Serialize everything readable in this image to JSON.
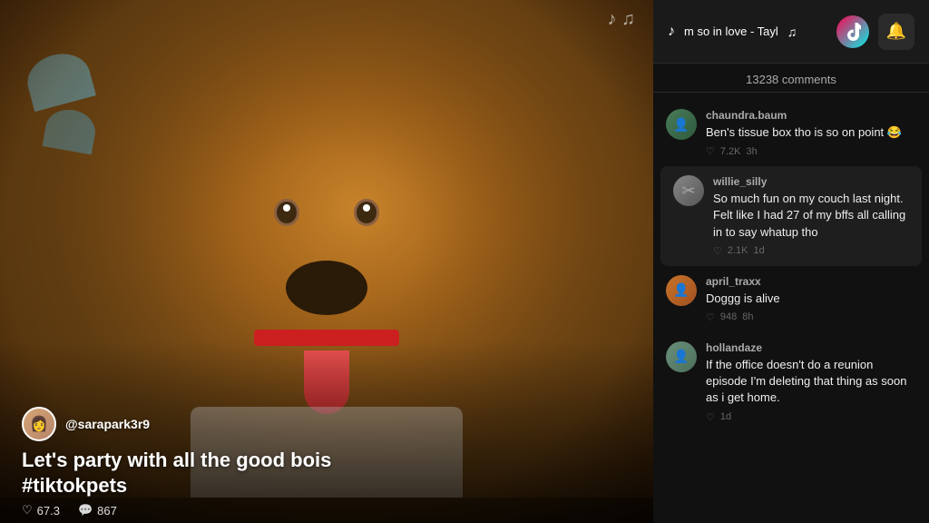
{
  "video": {
    "author": "@sarapark3r9",
    "caption": "Let's party with all the good bois #tiktokpets",
    "likes": "67.3",
    "comments_count_video": "867",
    "music_notes": "♪ ♫"
  },
  "header": {
    "song_title": "m so in love - Tayl",
    "music_icon": "♪",
    "bell_icon": "🔔"
  },
  "comments": {
    "total": "13238 comments",
    "items": [
      {
        "username": "chaundra.baum",
        "text": "Ben's tissue box tho is so on point 😂",
        "time": "3h",
        "likes": "7.2K",
        "avatar_emoji": "👤",
        "highlighted": false
      },
      {
        "username": "willie_silly",
        "text": "So much fun on my couch last night. Felt like I had 27 of my bffs all calling in to say whatup tho",
        "time": "1d",
        "likes": "2.1K",
        "avatar_emoji": "✂",
        "highlighted": true
      },
      {
        "username": "april_traxx",
        "text": "Doggg is alive",
        "time": "8h",
        "likes": "948",
        "avatar_emoji": "👤",
        "highlighted": false
      },
      {
        "username": "hollandaze",
        "text": "If the office doesn't do a reunion episode I'm deleting that thing as soon as i get home.",
        "time": "1d",
        "likes": "",
        "avatar_emoji": "👤",
        "highlighted": false
      }
    ]
  }
}
